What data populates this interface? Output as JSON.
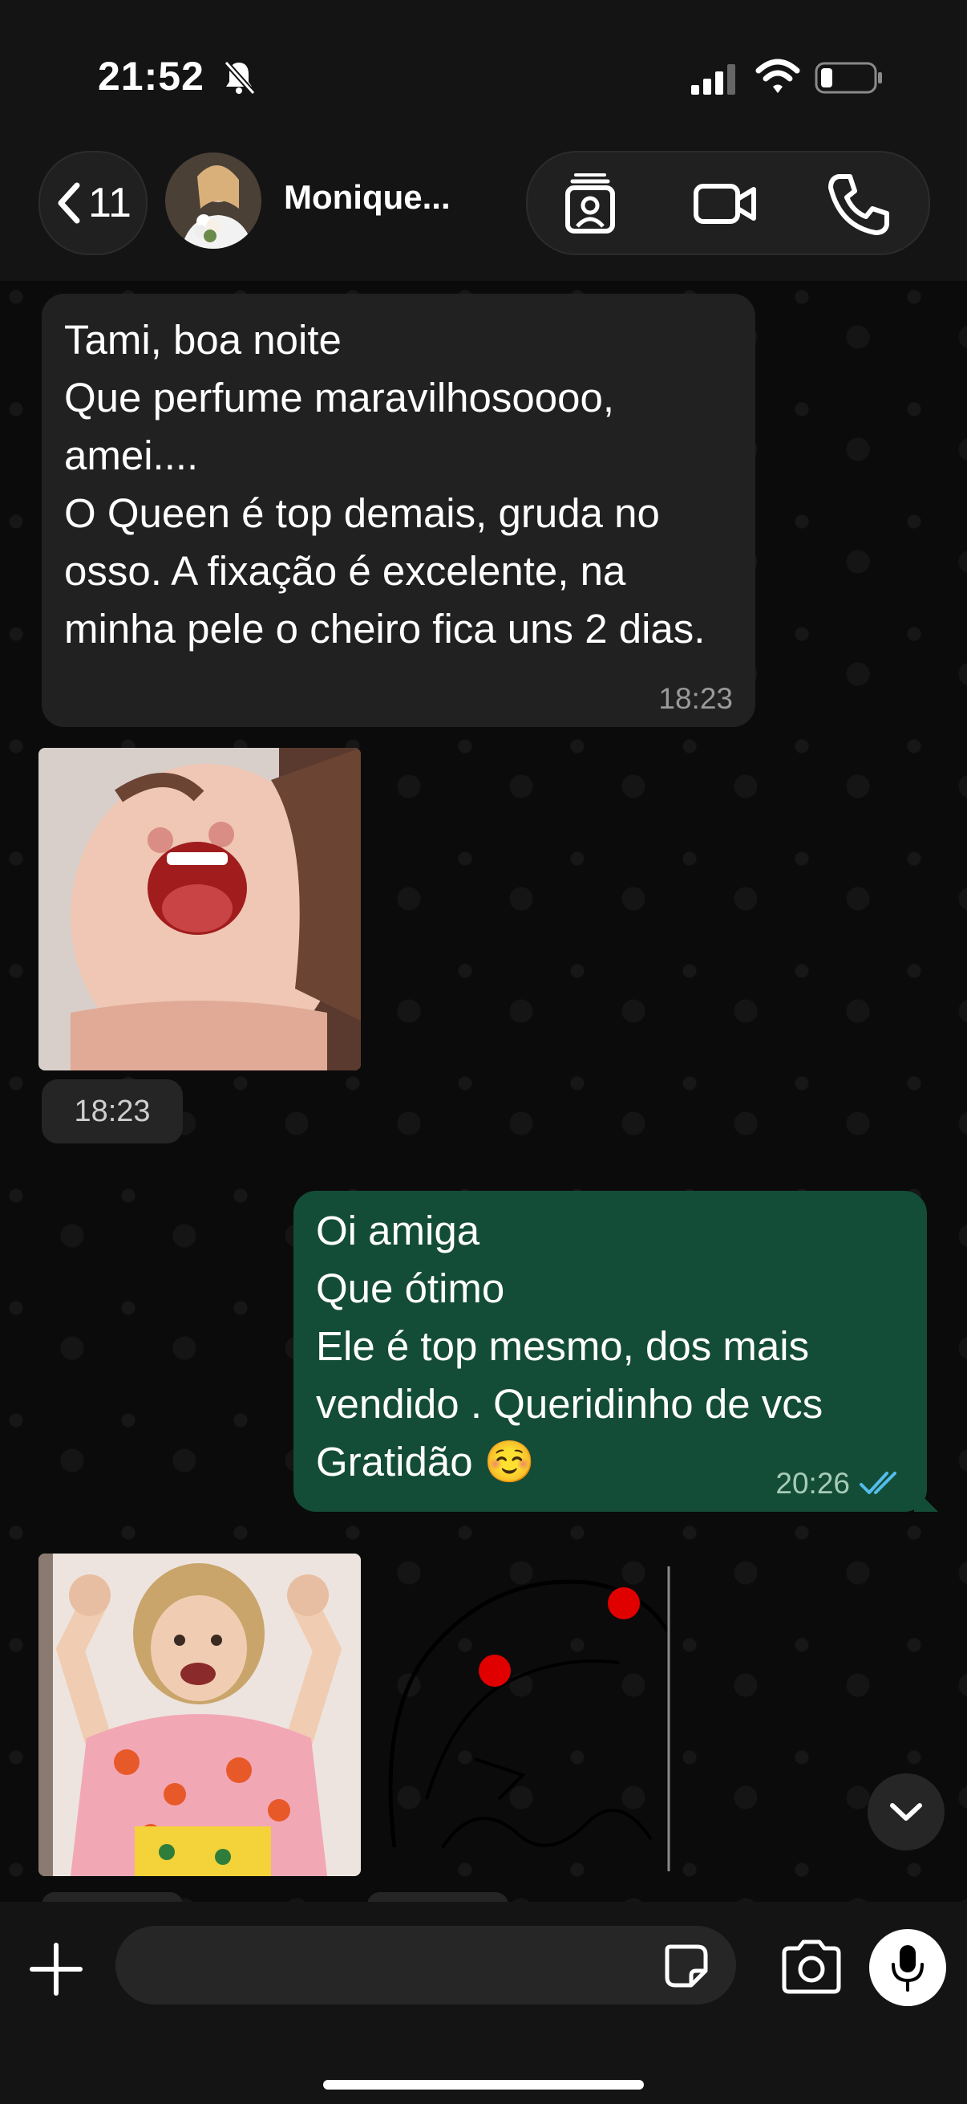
{
  "status_bar": {
    "time": "21:52"
  },
  "header": {
    "back_count": "11",
    "contact_name": "Monique..."
  },
  "messages": [
    {
      "direction": "in",
      "text": "Tami, boa noite\nQue perfume maravilhosoooo, amei....\nO Queen é top demais, gruda no osso. A fixação é excelente, na minha pele o cheiro  fica uns 2 dias.",
      "time": "18:23"
    },
    {
      "direction": "in",
      "type": "gif",
      "time": "18:23"
    },
    {
      "direction": "out",
      "text": "Oi amiga\nQue ótimo\nEle é top mesmo, dos mais vendido . Queridinho de vcs\nGratidão ☺️",
      "time": "20:26",
      "status": "read"
    },
    {
      "direction": "in",
      "type": "gif"
    },
    {
      "direction": "in",
      "type": "sticker"
    }
  ],
  "colors": {
    "incoming_bubble": "#212121",
    "outgoing_bubble": "#144d37",
    "read_ticks": "#53bdeb",
    "background": "#0b0b0b"
  },
  "input": {
    "placeholder": ""
  }
}
